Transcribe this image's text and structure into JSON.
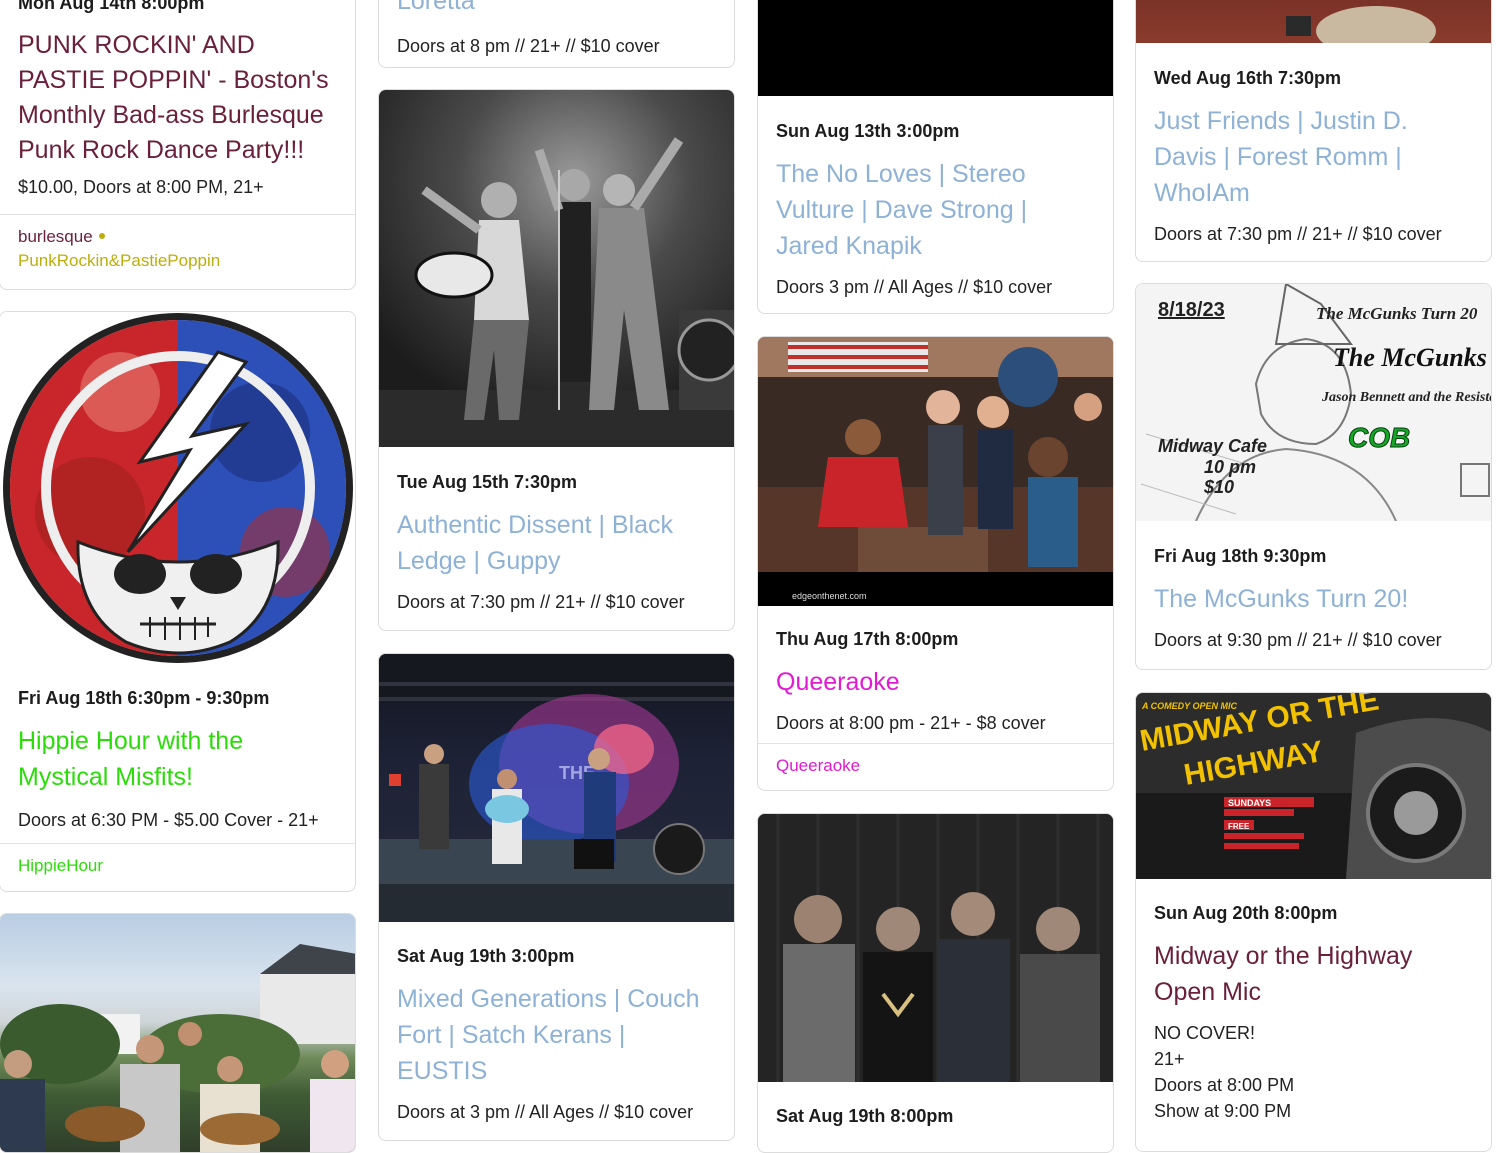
{
  "col1": {
    "card1": {
      "date": "Mon Aug 14th 8:00pm",
      "title": "PUNK ROCKIN' AND PASTIE POPPIN' - Boston's Monthly Bad-ass Burlesque Punk Rock Dance Party!!!",
      "info": "$10.00, Doors at 8:00 PM, 21+",
      "tag1": "burlesque",
      "tag2": "PunkRockin&PastiePoppin"
    },
    "card2": {
      "date": "Fri Aug 18th 6:30pm - 9:30pm",
      "title": "Hippie Hour with the Mystical Misfits!",
      "info": "Doors at 6:30 PM - $5.00 Cover - 21+",
      "tag1": "HippieHour"
    }
  },
  "col2": {
    "card1": {
      "title_partial": "Loretta",
      "info": "Doors at 8 pm // 21+ // $10 cover"
    },
    "card2": {
      "date": "Tue Aug 15th 7:30pm",
      "title": "Authentic Dissent | Black Ledge | Guppy",
      "info": "Doors at 7:30 pm // 21+ // $10 cover"
    },
    "card3": {
      "date": "Sat Aug 19th 3:00pm",
      "title": "Mixed Generations | Couch Fort | Satch Kerans | EUSTIS",
      "info": "Doors at 3 pm // All Ages // $10 cover",
      "image_text": "THE"
    }
  },
  "col3": {
    "card1": {
      "date": "Sun Aug 13th 3:00pm",
      "title": "The No Loves | Stereo Vulture | Dave Strong | Jared Knapik",
      "info": "Doors 3 pm // All Ages // $10 cover"
    },
    "card2": {
      "date": "Thu Aug 17th 8:00pm",
      "title": "Queeraoke",
      "info": "Doors at 8:00 pm - 21+ - $8 cover",
      "tag1": "Queeraoke",
      "image_logo": "edge",
      "image_caption": "edgeonthenet.com"
    },
    "card3": {
      "date": "Sat Aug 19th 8:00pm"
    }
  },
  "col4": {
    "card1": {
      "date": "Wed Aug 16th 7:30pm",
      "title": "Just Friends | Justin D. Davis | Forest Romm | WhoIAm",
      "info": "Doors at 7:30 pm // 21+ // $10 cover"
    },
    "card2": {
      "date": "Fri Aug 18th 9:30pm",
      "title": "The McGunks Turn 20!",
      "info": "Doors at 9:30 pm // 21+ // $10 cover",
      "poster": {
        "date": "8/18/23",
        "top": "The McGunks Turn 20",
        "band1": "The McGunks",
        "band2": "Jason Bennett and the Resistance",
        "band3": "COB",
        "venue": "Midway Cafe",
        "time": "10 pm",
        "price": "$10"
      }
    },
    "card3": {
      "date": "Sun Aug 20th 8:00pm",
      "title": "Midway or the Highway Open Mic",
      "info_lines": [
        "NO COVER!",
        "21+",
        "Doors at 8:00 PM",
        "Show at 9:00 PM"
      ],
      "poster": {
        "kicker": "A COMEDY OPEN MIC",
        "headline1": "MIDWAY OR THE",
        "headline2": "HIGHWAY",
        "days": "SUNDAYS",
        "free": "FREE"
      }
    }
  }
}
